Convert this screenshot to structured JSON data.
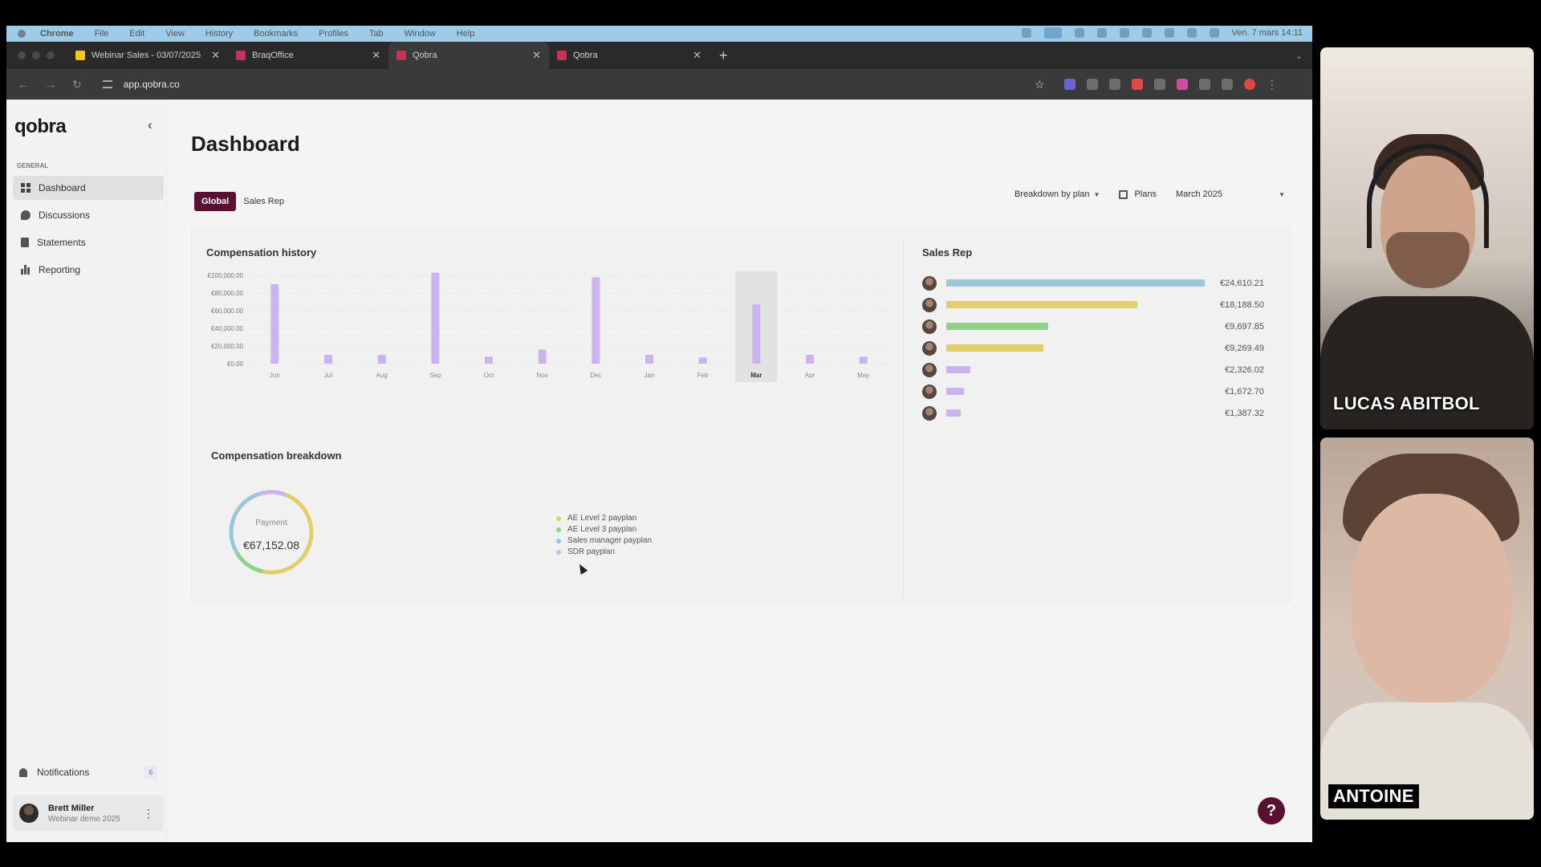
{
  "menubar": {
    "app": "Chrome",
    "items": [
      "File",
      "Edit",
      "View",
      "History",
      "Bookmarks",
      "Profiles",
      "Tab",
      "Window",
      "Help"
    ],
    "clock": "Ven. 7 mars 14:11"
  },
  "browser": {
    "tabs": [
      {
        "title": "Webinar Sales - 03/07/2025",
        "favicon": "sheets-icon"
      },
      {
        "title": "BraqOffice",
        "favicon": "qobra-icon"
      },
      {
        "title": "Qobra",
        "favicon": "qobra-icon"
      },
      {
        "title": "Qobra",
        "favicon": "qobra-icon"
      }
    ],
    "new_tab": "+",
    "url": "app.qobra.co"
  },
  "sidebar": {
    "logo": "qobra",
    "section": "GENERAL",
    "items": [
      {
        "label": "Dashboard",
        "icon": "grid-icon"
      },
      {
        "label": "Discussions",
        "icon": "chat-icon"
      },
      {
        "label": "Statements",
        "icon": "document-icon"
      },
      {
        "label": "Reporting",
        "icon": "bar-chart-icon"
      }
    ],
    "notifications": {
      "label": "Notifications",
      "count": "6"
    },
    "user": {
      "name": "Brett Miller",
      "subtitle": "Webinar demo 2025"
    }
  },
  "main": {
    "title": "Dashboard",
    "segments": [
      "Global",
      "Sales Rep"
    ],
    "filters": {
      "breakdown": "Breakdown by plan",
      "plans": "Plans",
      "month": "March 2025"
    },
    "compensation_history": {
      "title": "Compensation history"
    },
    "compensation_breakdown": {
      "title": "Compensation breakdown",
      "donut_label": "Payment",
      "donut_value": "€67,152.08",
      "legend": [
        {
          "label": "AE Level 2 payplan",
          "color": "#e3cf6a"
        },
        {
          "label": "AE Level 3 payplan",
          "color": "#8fd08a"
        },
        {
          "label": "Sales manager payplan",
          "color": "#9cc7d9"
        },
        {
          "label": "SDR payplan",
          "color": "#c9b4f0"
        }
      ]
    },
    "sales_rep": {
      "title": "Sales Rep",
      "rows": [
        {
          "amount": "€24,610.21",
          "value": 24610.21,
          "color": "#9cc7d9"
        },
        {
          "amount": "€18,188.50",
          "value": 18188.5,
          "color": "#e3cf6a"
        },
        {
          "amount": "€9,697.85",
          "value": 9697.85,
          "color": "#8fd08a"
        },
        {
          "amount": "€9,269.49",
          "value": 9269.49,
          "color": "#e3cf6a"
        },
        {
          "amount": "€2,326.02",
          "value": 2326.02,
          "color": "#c9b4f0"
        },
        {
          "amount": "€1,672.70",
          "value": 1672.7,
          "color": "#c9b4f0"
        },
        {
          "amount": "€1,387.32",
          "value": 1387.32,
          "color": "#c9b4f0"
        }
      ]
    }
  },
  "chart_data": {
    "type": "bar",
    "title": "Compensation history",
    "categories": [
      "Jun",
      "Jul",
      "Aug",
      "Sep",
      "Oct",
      "Nov",
      "Dec",
      "Jan",
      "Feb",
      "Mar",
      "Apr",
      "May"
    ],
    "values": [
      90000,
      10000,
      10000,
      103000,
      8000,
      16000,
      98000,
      10000,
      7000,
      67152.08,
      10000,
      8000
    ],
    "y_ticks": [
      "€100,000.00",
      "€80,000.00",
      "€60,000.00",
      "€40,000.00",
      "€20,000.00",
      "€0.00"
    ],
    "ylim": [
      0,
      100000
    ],
    "highlighted": "Mar",
    "bar_color": "#c9b4f0",
    "grid": true
  },
  "participants": [
    {
      "name": "LUCAS ABITBOL"
    },
    {
      "name": "ANTOINE"
    }
  ],
  "help": "?"
}
